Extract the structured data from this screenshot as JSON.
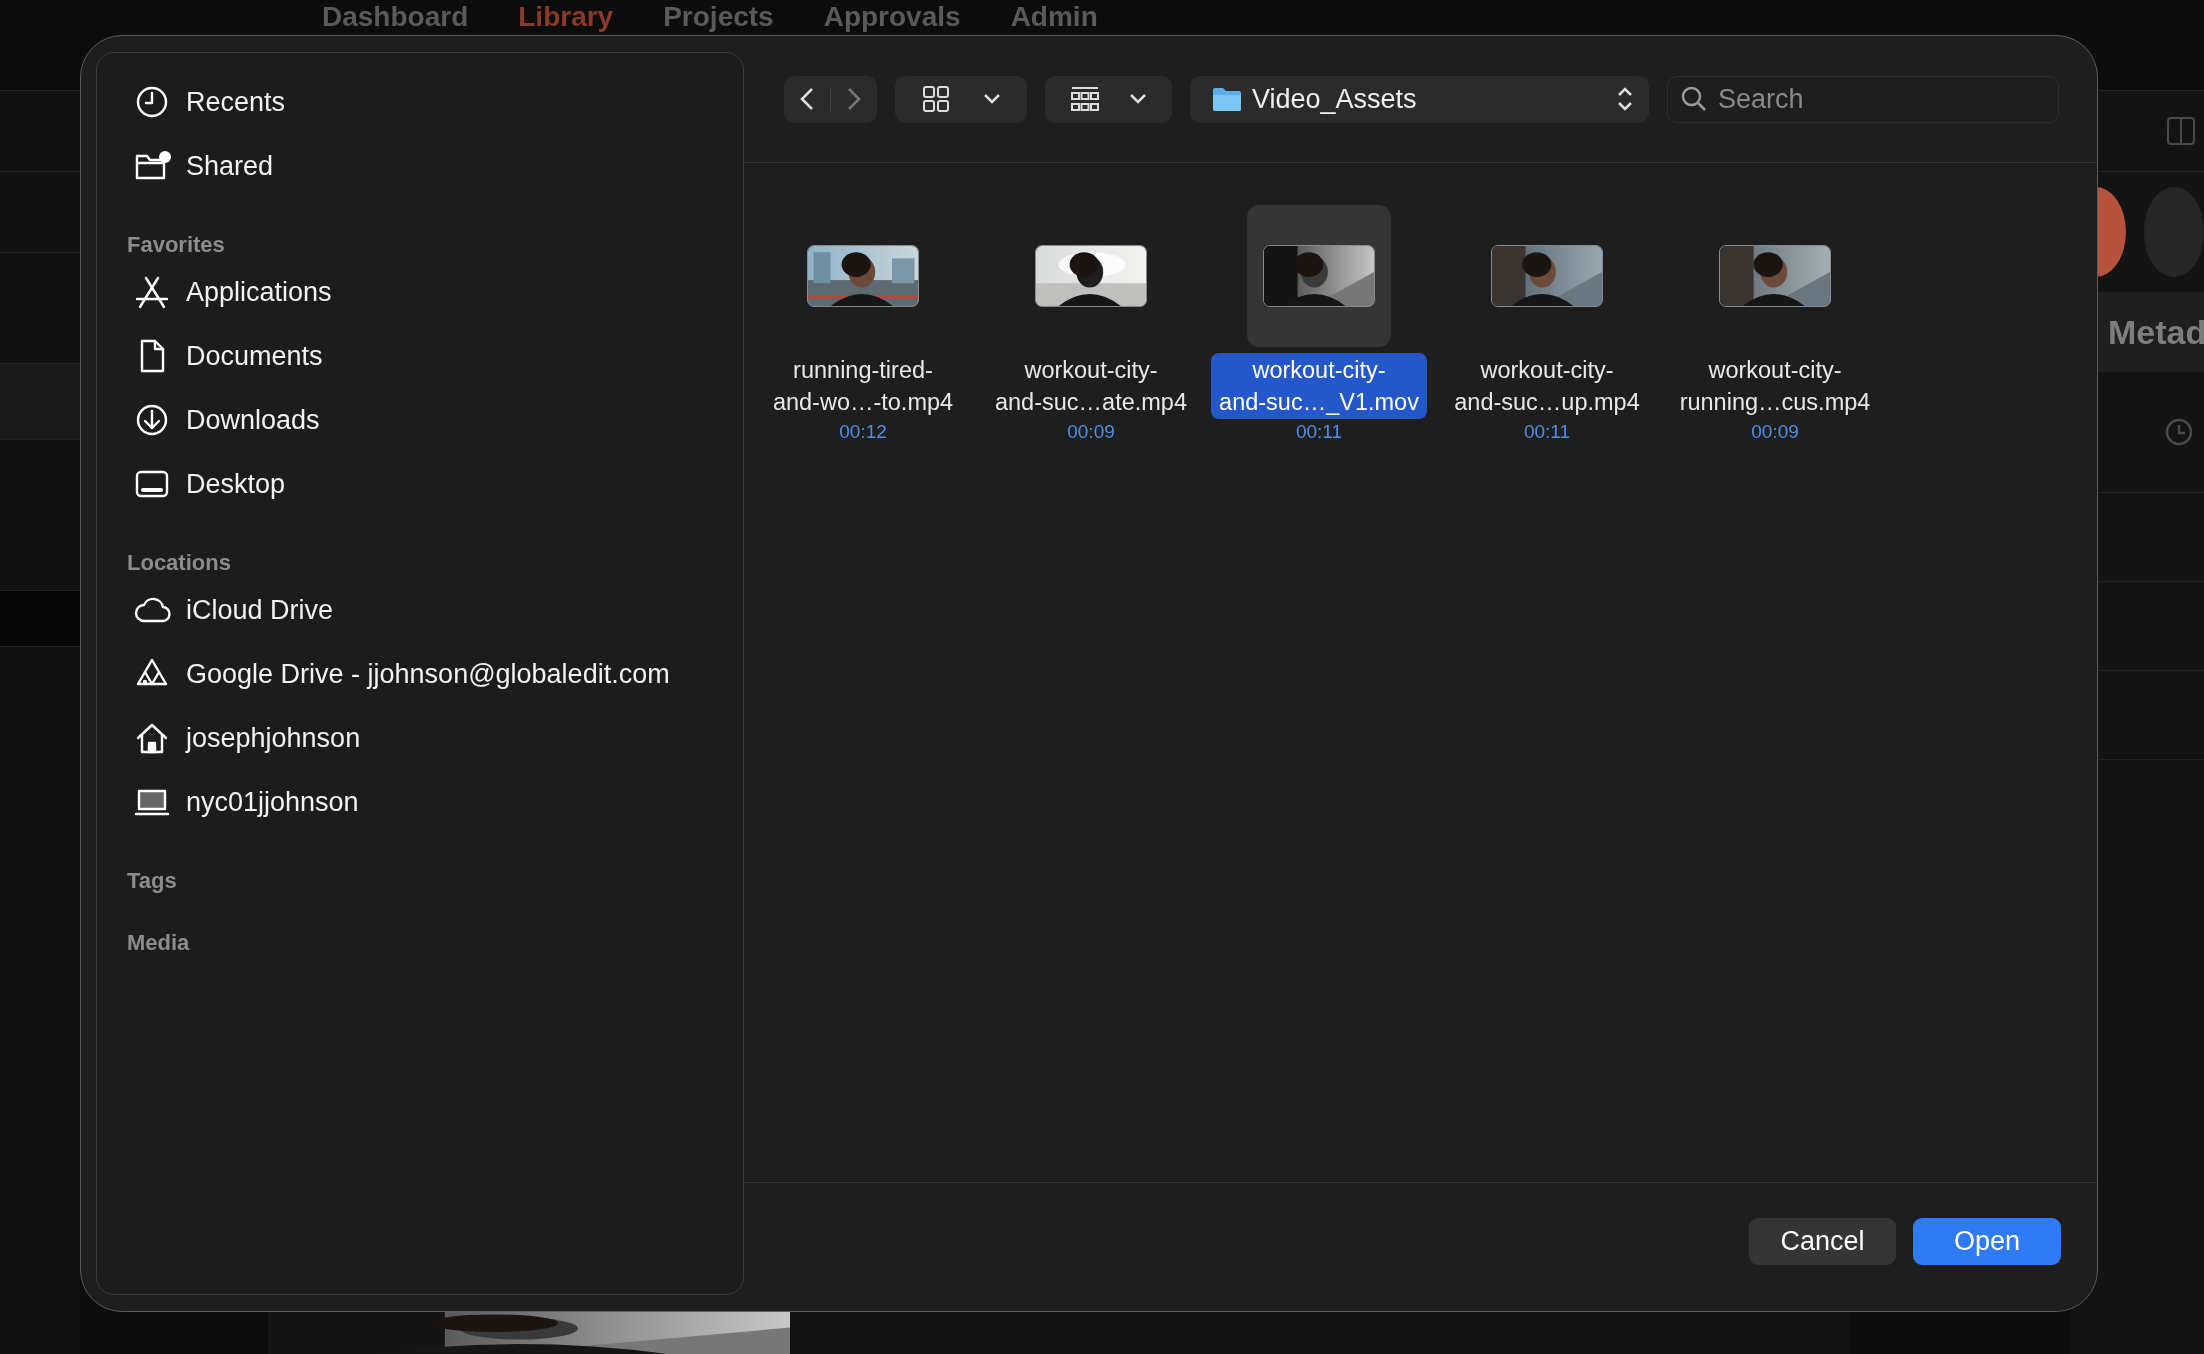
{
  "background_app": {
    "nav": [
      {
        "label": "Dashboard",
        "selected": false
      },
      {
        "label": "Library",
        "selected": true
      },
      {
        "label": "Projects",
        "selected": false
      },
      {
        "label": "Approvals",
        "selected": false
      },
      {
        "label": "Admin",
        "selected": false
      }
    ],
    "panel_title": "Metad"
  },
  "dialog": {
    "sidebar": [
      {
        "items": [
          {
            "label": "Recents",
            "kind": "recents"
          },
          {
            "label": "Shared",
            "kind": "shared"
          }
        ]
      },
      {
        "title": "Favorites",
        "items": [
          {
            "label": "Applications",
            "kind": "applications"
          },
          {
            "label": "Documents",
            "kind": "document"
          },
          {
            "label": "Downloads",
            "kind": "downloads"
          },
          {
            "label": "Desktop",
            "kind": "desktop"
          }
        ]
      },
      {
        "title": "Locations",
        "items": [
          {
            "label": "iCloud Drive",
            "kind": "cloud"
          },
          {
            "label": "Google Drive - jjohnson@globaledit.com",
            "kind": "drive"
          },
          {
            "label": "josephjohnson",
            "kind": "home"
          },
          {
            "label": "nyc01jjohnson",
            "kind": "computer"
          }
        ]
      },
      {
        "title": "Tags"
      },
      {
        "title": "Media"
      }
    ],
    "path": "Video_Assets",
    "search": {
      "placeholder": "Search"
    },
    "files": [
      {
        "name_lines": [
          "running-tired-",
          "and-wo…-to.mp4"
        ],
        "duration": "00:12",
        "selected": false
      },
      {
        "name_lines": [
          "workout-city-",
          "and-suc…ate.mp4"
        ],
        "duration": "00:09",
        "selected": false
      },
      {
        "name_lines": [
          "workout-city-",
          "and-suc…_V1.mov"
        ],
        "duration": "00:11",
        "selected": true
      },
      {
        "name_lines": [
          "workout-city-",
          "and-suc…up.mp4"
        ],
        "duration": "00:11",
        "selected": false
      },
      {
        "name_lines": [
          "workout-city-",
          "running…cus.mp4"
        ],
        "duration": "00:09",
        "selected": false
      }
    ],
    "buttons": [
      {
        "label": "Cancel",
        "kind": "secondary"
      },
      {
        "label": "Open",
        "kind": "primary"
      }
    ]
  }
}
